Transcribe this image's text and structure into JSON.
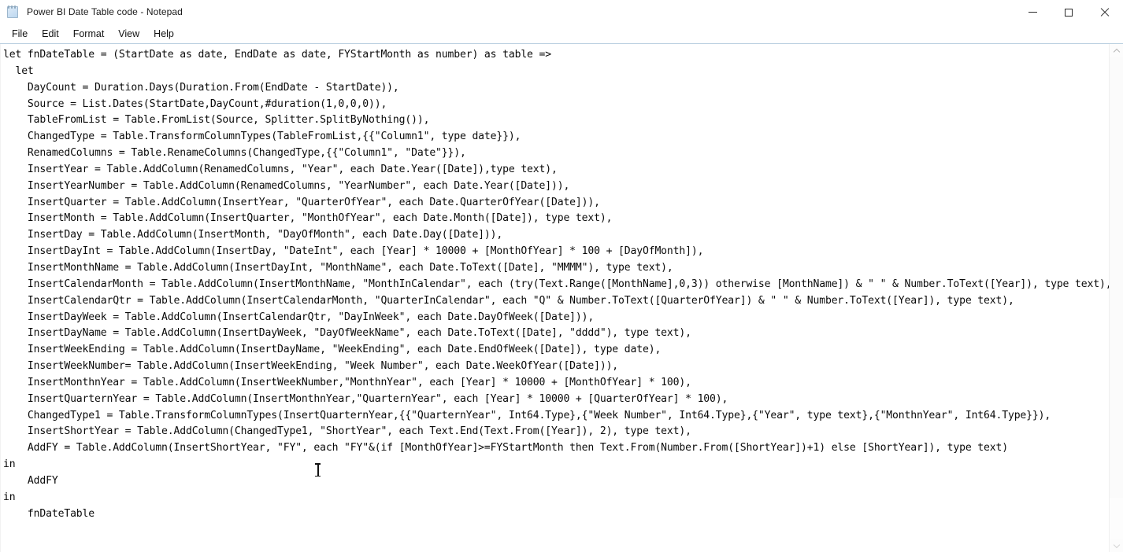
{
  "window": {
    "title": "Power BI Date Table code - Notepad",
    "app_icon": "notepad-icon",
    "controls": {
      "minimize": "minimize-button",
      "maximize": "maximize-button",
      "close": "close-button"
    }
  },
  "menubar": {
    "items": [
      {
        "label": "File"
      },
      {
        "label": "Edit"
      },
      {
        "label": "Format"
      },
      {
        "label": "View"
      },
      {
        "label": "Help"
      }
    ]
  },
  "editor": {
    "wordwrap": false,
    "lines": [
      "let fnDateTable = (StartDate as date, EndDate as date, FYStartMonth as number) as table =>",
      "  let",
      "    DayCount = Duration.Days(Duration.From(EndDate - StartDate)),",
      "    Source = List.Dates(StartDate,DayCount,#duration(1,0,0,0)),",
      "    TableFromList = Table.FromList(Source, Splitter.SplitByNothing()),",
      "    ChangedType = Table.TransformColumnTypes(TableFromList,{{\"Column1\", type date}}),",
      "    RenamedColumns = Table.RenameColumns(ChangedType,{{\"Column1\", \"Date\"}}),",
      "    InsertYear = Table.AddColumn(RenamedColumns, \"Year\", each Date.Year([Date]),type text),",
      "    InsertYearNumber = Table.AddColumn(RenamedColumns, \"YearNumber\", each Date.Year([Date])),",
      "    InsertQuarter = Table.AddColumn(InsertYear, \"QuarterOfYear\", each Date.QuarterOfYear([Date])),",
      "    InsertMonth = Table.AddColumn(InsertQuarter, \"MonthOfYear\", each Date.Month([Date]), type text),",
      "    InsertDay = Table.AddColumn(InsertMonth, \"DayOfMonth\", each Date.Day([Date])),",
      "    InsertDayInt = Table.AddColumn(InsertDay, \"DateInt\", each [Year] * 10000 + [MonthOfYear] * 100 + [DayOfMonth]),",
      "    InsertMonthName = Table.AddColumn(InsertDayInt, \"MonthName\", each Date.ToText([Date], \"MMMM\"), type text),",
      "    InsertCalendarMonth = Table.AddColumn(InsertMonthName, \"MonthInCalendar\", each (try(Text.Range([MonthName],0,3)) otherwise [MonthName]) & \" \" & Number.ToText([Year]), type text),",
      "    InsertCalendarQtr = Table.AddColumn(InsertCalendarMonth, \"QuarterInCalendar\", each \"Q\" & Number.ToText([QuarterOfYear]) & \" \" & Number.ToText([Year]), type text),",
      "    InsertDayWeek = Table.AddColumn(InsertCalendarQtr, \"DayInWeek\", each Date.DayOfWeek([Date])),",
      "    InsertDayName = Table.AddColumn(InsertDayWeek, \"DayOfWeekName\", each Date.ToText([Date], \"dddd\"), type text),",
      "    InsertWeekEnding = Table.AddColumn(InsertDayName, \"WeekEnding\", each Date.EndOfWeek([Date]), type date),",
      "    InsertWeekNumber= Table.AddColumn(InsertWeekEnding, \"Week Number\", each Date.WeekOfYear([Date])),",
      "    InsertMonthnYear = Table.AddColumn(InsertWeekNumber,\"MonthnYear\", each [Year] * 10000 + [MonthOfYear] * 100),",
      "    InsertQuarternYear = Table.AddColumn(InsertMonthnYear,\"QuarternYear\", each [Year] * 10000 + [QuarterOfYear] * 100),",
      "    ChangedType1 = Table.TransformColumnTypes(InsertQuarternYear,{{\"QuarternYear\", Int64.Type},{\"Week Number\", Int64.Type},{\"Year\", type text},{\"MonthnYear\", Int64.Type}}),",
      "    InsertShortYear = Table.AddColumn(ChangedType1, \"ShortYear\", each Text.End(Text.From([Year]), 2), type text),",
      "    AddFY = Table.AddColumn(InsertShortYear, \"FY\", each \"FY\"&(if [MonthOfYear]>=FYStartMonth then Text.From(Number.From([ShortYear])+1) else [ShortYear]), type text)",
      "in",
      "    AddFY",
      "in",
      "    fnDateTable"
    ]
  },
  "scrollbar": {
    "up_arrow": "scroll-up-arrow",
    "down_arrow": "scroll-down-arrow"
  },
  "colors": {
    "title_text": "#1a1a1a",
    "code_text": "#0a0a0a",
    "menu_separator": "#b9cfe0",
    "background": "#ffffff"
  }
}
